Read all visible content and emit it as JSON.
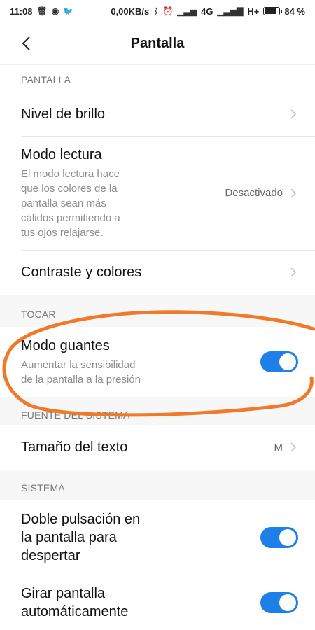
{
  "statusbar": {
    "time": "11:08",
    "speed": "0,00KB/s",
    "net1": "4G",
    "net2": "H+",
    "battery": "84 %",
    "battery_level": 0.84
  },
  "header": {
    "title": "Pantalla"
  },
  "sections": {
    "pantalla": "PANTALLA",
    "tocar": "TOCAR",
    "fuente": "FUENTE DEL SISTEMA",
    "sistema": "SISTEMA"
  },
  "rows": {
    "brillo": {
      "title": "Nivel de brillo"
    },
    "lectura": {
      "title": "Modo lectura",
      "sub": "El modo lectura hace que los colores de la pantalla sean más cálidos permitiendo a tus ojos relajarse.",
      "value": "Desactivado"
    },
    "contraste": {
      "title": "Contraste y colores"
    },
    "guantes": {
      "title": "Modo guantes",
      "sub": "Aumentar la sensibilidad de la pantalla a la presión",
      "enabled": true
    },
    "tamano": {
      "title": "Tamaño del texto",
      "value": "M"
    },
    "doble": {
      "title": "Doble pulsación en la pantalla para despertar",
      "enabled": true
    },
    "girar": {
      "title": "Girar pantalla automáticamente",
      "enabled": true
    }
  },
  "colors": {
    "accent": "#1e7fe8",
    "annotation": "#f07a2a"
  }
}
